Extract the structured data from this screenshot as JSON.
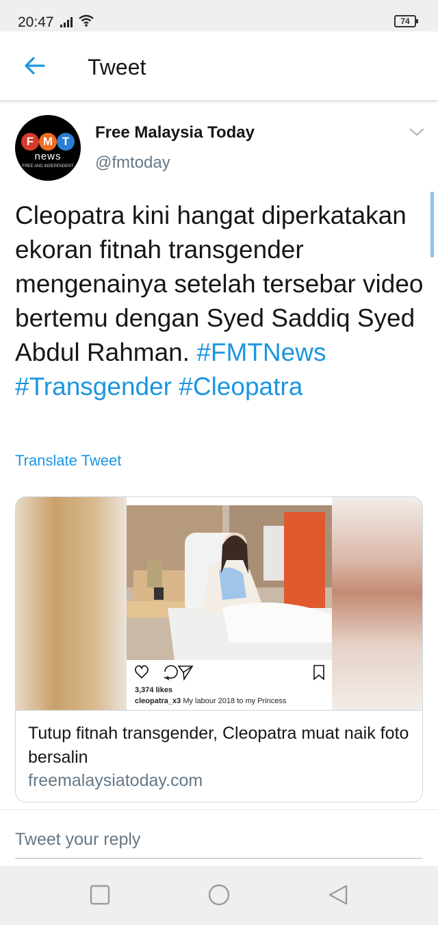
{
  "status_bar": {
    "time": "20:47",
    "battery": "74"
  },
  "app_bar": {
    "title": "Tweet"
  },
  "author": {
    "name": "Free Malaysia Today",
    "handle": "@fmtoday"
  },
  "avatar": {
    "letters": [
      "F",
      "M",
      "T"
    ],
    "news": "news",
    "tagline": "FREE AND INDEPENDENT"
  },
  "tweet": {
    "text": "Cleopatra kini hangat diperkatakan ekoran fitnah transgender mengenainya setelah tersebar video bertemu dengan Syed Saddiq Syed Abdul Rahman.",
    "hashtags": [
      "#FMTNews",
      "#Transgender",
      "#Cleopatra"
    ],
    "translate_label": "Translate Tweet"
  },
  "card": {
    "instagram_likes": "3,374 likes",
    "instagram_user": "cleopatra_x3",
    "instagram_caption": "My labour 2018 to my Princess",
    "title": "Tutup fitnah transgender, Cleopatra muat naik foto bersalin",
    "domain": "freemalaysiatoday.com"
  },
  "reply": {
    "placeholder": "Tweet your reply"
  },
  "colors": {
    "accent": "#1b95e0",
    "secondary_text": "#657786",
    "fmt_red": "#d63a2b",
    "fmt_orange": "#ef6b22",
    "fmt_blue": "#2a7fd4"
  },
  "icons": [
    "signal-icon",
    "wifi-icon",
    "battery-icon",
    "back-arrow-icon",
    "chevron-down-icon",
    "heart-icon",
    "comment-icon",
    "share-icon",
    "bookmark-icon",
    "square-nav-icon",
    "circle-nav-icon",
    "triangle-back-nav-icon"
  ]
}
